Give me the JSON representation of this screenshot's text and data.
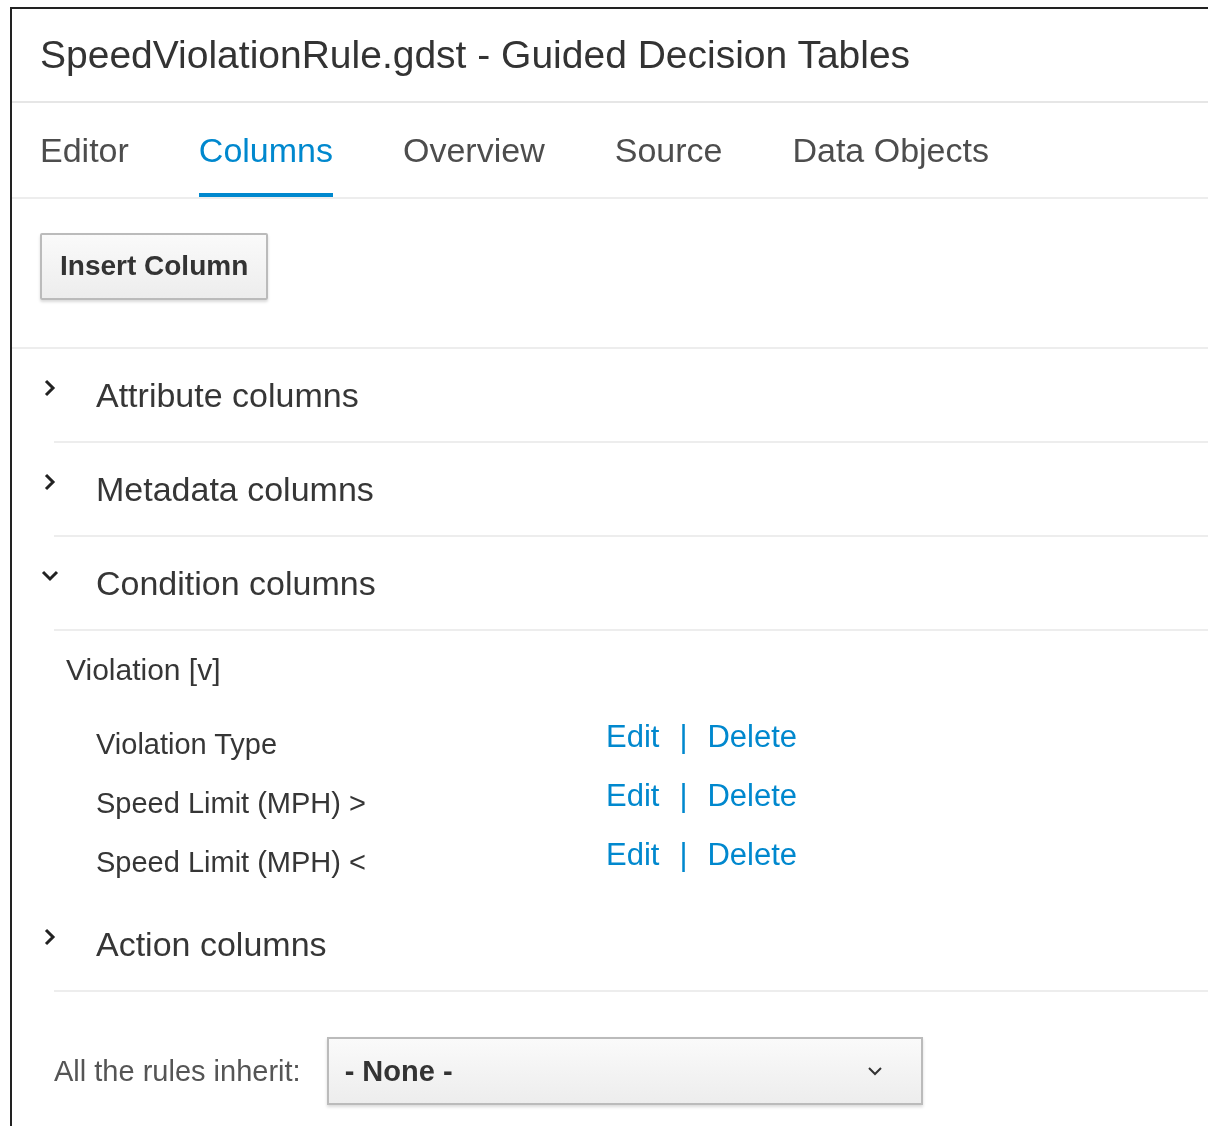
{
  "window": {
    "title": "SpeedViolationRule.gdst - Guided Decision Tables"
  },
  "tabs": [
    {
      "label": "Editor",
      "selected": false
    },
    {
      "label": "Columns",
      "selected": true
    },
    {
      "label": "Overview",
      "selected": false
    },
    {
      "label": "Source",
      "selected": false
    },
    {
      "label": "Data Objects",
      "selected": false
    }
  ],
  "insert_button": "Insert Column",
  "sections": [
    {
      "label": "Attribute columns",
      "expanded": false
    },
    {
      "label": "Metadata columns",
      "expanded": false
    },
    {
      "label": "Condition columns",
      "expanded": true,
      "groups": [
        {
          "title": "Violation [v]",
          "columns": [
            {
              "name": "Violation Type",
              "edit": "Edit",
              "separator": "|",
              "delete": "Delete"
            },
            {
              "name": "Speed Limit (MPH) >",
              "edit": "Edit",
              "separator": "|",
              "delete": "Delete"
            },
            {
              "name": "Speed Limit (MPH) <",
              "edit": "Edit",
              "separator": "|",
              "delete": "Delete"
            }
          ]
        }
      ]
    },
    {
      "label": "Action columns",
      "expanded": false
    }
  ],
  "inherit": {
    "label": "All the rules inherit:",
    "value": "- None -"
  }
}
